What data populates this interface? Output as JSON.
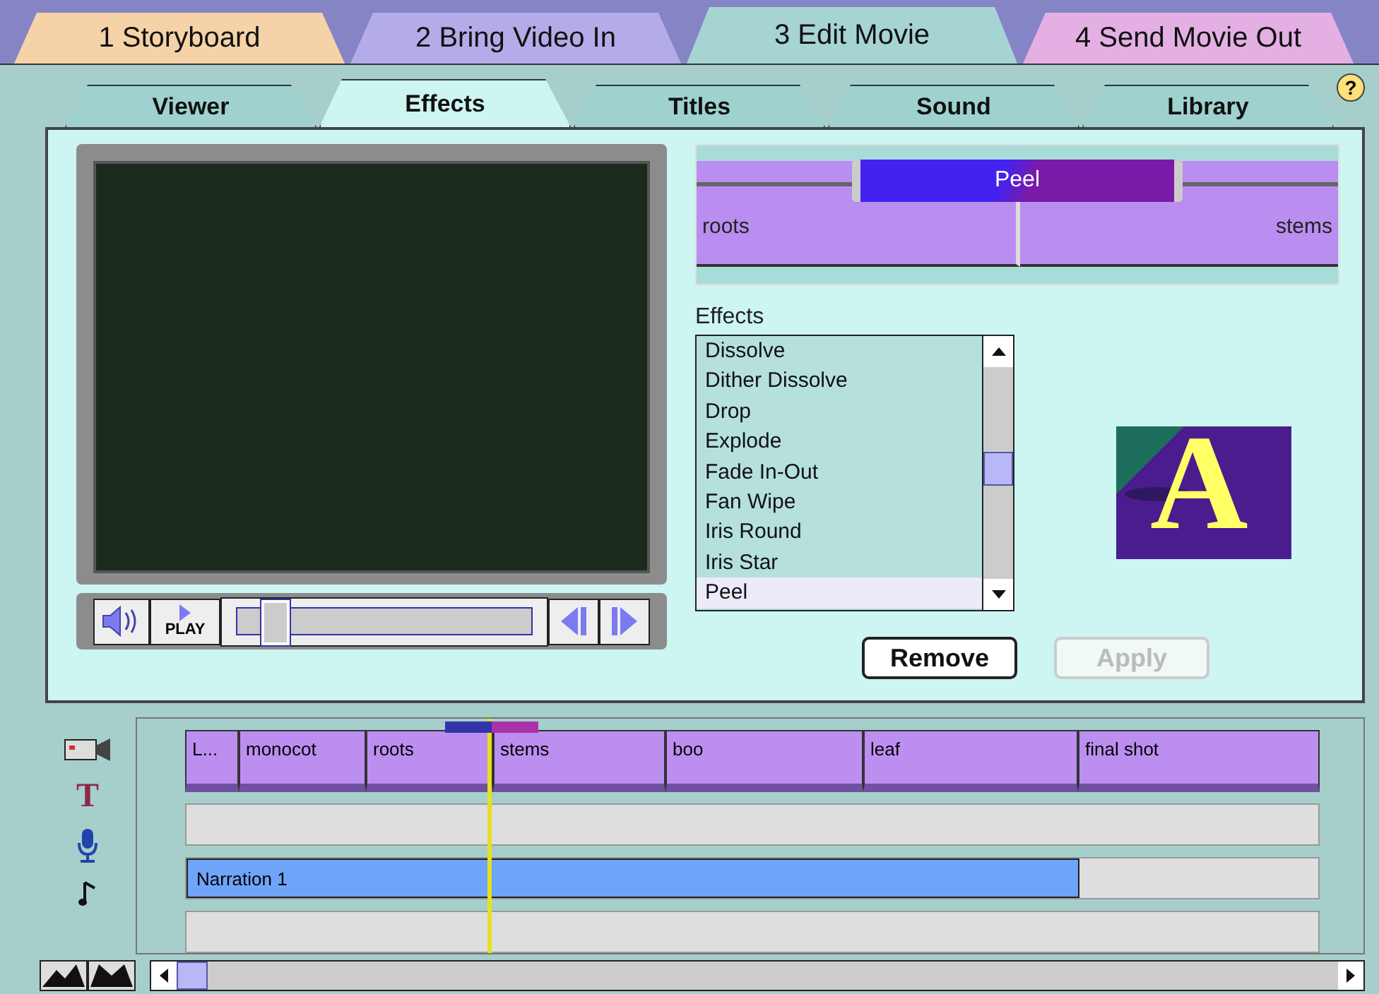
{
  "main_tabs": [
    {
      "label": "1 Storyboard",
      "selected": false,
      "color": "#f6d2a8"
    },
    {
      "label": "2 Bring Video In",
      "selected": false,
      "color": "#b4ace8"
    },
    {
      "label": "3 Edit Movie",
      "selected": true,
      "color": "#a6d4d2"
    },
    {
      "label": "4 Send Movie Out",
      "selected": false,
      "color": "#e4b0e4"
    }
  ],
  "sub_tabs": [
    {
      "label": "Viewer",
      "selected": false
    },
    {
      "label": "Effects",
      "selected": true
    },
    {
      "label": "Titles",
      "selected": false
    },
    {
      "label": "Sound",
      "selected": false
    },
    {
      "label": "Library",
      "selected": false
    }
  ],
  "help_icon": "?",
  "player": {
    "play_label": "PLAY",
    "level": 0.08
  },
  "transition": {
    "name": "Peel",
    "clip_before": "roots",
    "clip_after": "stems"
  },
  "effects": {
    "label": "Effects",
    "items": [
      {
        "label": "Dissolve",
        "selected": false
      },
      {
        "label": "Dither Dissolve",
        "selected": false
      },
      {
        "label": "Drop",
        "selected": false
      },
      {
        "label": "Explode",
        "selected": false
      },
      {
        "label": "Fade In-Out",
        "selected": false
      },
      {
        "label": "Fan Wipe",
        "selected": false
      },
      {
        "label": "Iris Round",
        "selected": false
      },
      {
        "label": "Iris Star",
        "selected": false
      },
      {
        "label": "Peel",
        "selected": true
      }
    ],
    "preview_letter": "A"
  },
  "buttons": [
    {
      "label": "Remove",
      "disabled": false
    },
    {
      "label": "Apply",
      "disabled": true
    }
  ],
  "timeline": {
    "clips": [
      {
        "label": "L..."
      },
      {
        "label": "monocot"
      },
      {
        "label": "roots"
      },
      {
        "label": "stems"
      },
      {
        "label": "boo"
      },
      {
        "label": "leaf"
      },
      {
        "label": "final shot"
      }
    ],
    "title_icon": "T",
    "audio_clips": [
      {
        "label": "Narration 1"
      }
    ]
  }
}
